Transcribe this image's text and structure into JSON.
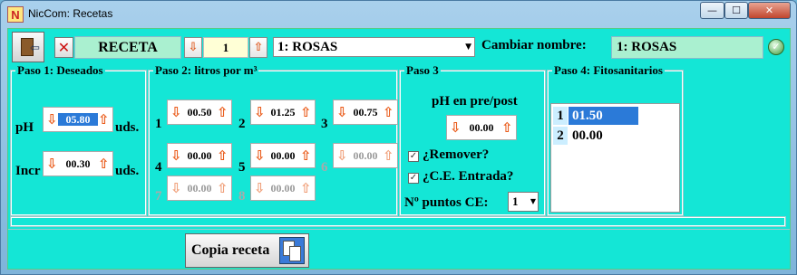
{
  "window": {
    "title": "NicCom: Recetas",
    "app_icon_glyph": "N",
    "min_glyph": "—",
    "max_glyph": "☐",
    "close_glyph": "✕"
  },
  "toolbar": {
    "exit_icon": "door-exit-icon",
    "delete_icon": "x-icon",
    "delete_glyph": "✕",
    "recipe_label": "RECETA",
    "recipe_number": "1",
    "recipe_selected": "1: ROSAS",
    "rename_label": "Cambiar nombre:",
    "rename_value": "1: ROSAS",
    "ok_glyph": "✓"
  },
  "paso1": {
    "title": "Paso 1: Deseados",
    "ph_label": "pH",
    "ph_value": "05.80",
    "ph_unit": "uds.",
    "incr_label": "Incr",
    "incr_value": "00.30",
    "incr_unit": "uds."
  },
  "paso2": {
    "title": "Paso 2: litros por m³",
    "items": [
      {
        "label": "1",
        "value": "00.50",
        "enabled": true
      },
      {
        "label": "2",
        "value": "01.25",
        "enabled": true
      },
      {
        "label": "3",
        "value": "00.75",
        "enabled": true
      },
      {
        "label": "4",
        "value": "00.00",
        "enabled": true
      },
      {
        "label": "5",
        "value": "00.00",
        "enabled": true
      },
      {
        "label": "6",
        "value": "00.00",
        "enabled": false
      },
      {
        "label": "7",
        "value": "00.00",
        "enabled": false
      },
      {
        "label": "8",
        "value": "00.00",
        "enabled": false
      }
    ]
  },
  "paso3": {
    "title": "Paso 3",
    "ph_prepost_label": "pH en pre/post",
    "ph_prepost_value": "00.00",
    "remover_label": "¿Remover?",
    "remover_checked": true,
    "ce_label": "¿C.E. Entrada?",
    "ce_checked": true,
    "puntos_label": "Nº puntos CE:",
    "puntos_value": "1"
  },
  "paso4": {
    "title": "Paso 4: Fitosanitarios",
    "items": [
      {
        "index": "1",
        "value": "01.50",
        "selected": true
      },
      {
        "index": "2",
        "value": "00.00",
        "selected": false
      }
    ]
  },
  "copy_button": {
    "label": "Copia receta",
    "icon": "copy-icon"
  },
  "glyphs": {
    "down": "⇩",
    "up": "⇧",
    "check": "✓",
    "dropdown": "▼"
  },
  "colors": {
    "background": "#14e6d6",
    "field_green": "#aaf0d0",
    "selection": "#2b7ad8",
    "arrow_orange": "#ea5b1a"
  }
}
